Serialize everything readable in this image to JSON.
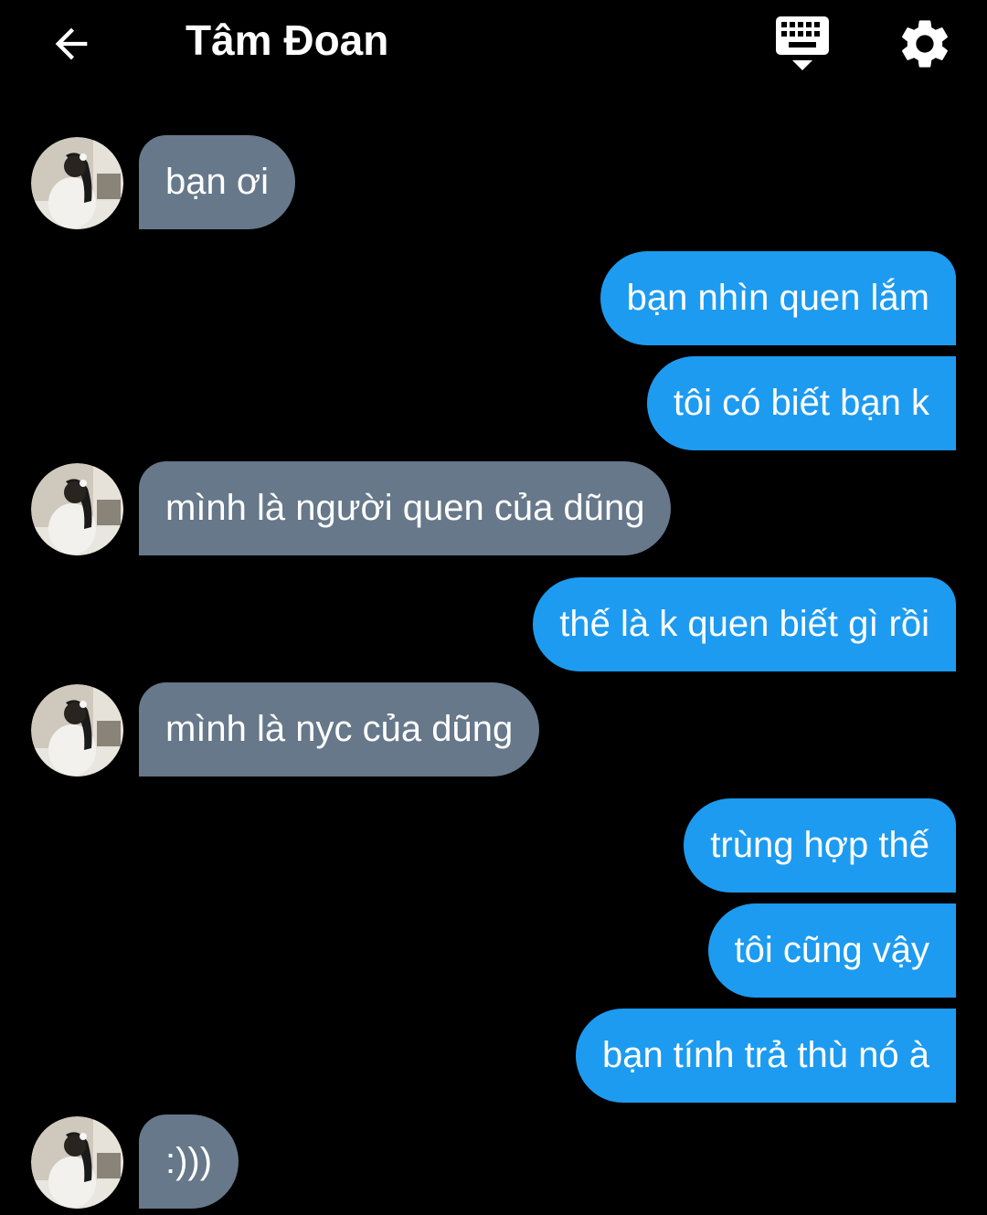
{
  "header": {
    "title": "Tâm Đoan",
    "back_icon": "arrow-left-icon",
    "keyboard_icon": "keyboard-icon",
    "settings_icon": "gear-icon"
  },
  "colors": {
    "background": "#000000",
    "incoming_bubble": "#66788a",
    "outgoing_bubble": "#1d9bf0",
    "text": "#ffffff"
  },
  "messages": [
    {
      "direction": "in",
      "text": "bạn ơi"
    },
    {
      "direction": "out",
      "text": "bạn nhìn quen lắm"
    },
    {
      "direction": "out",
      "text": "tôi có biết bạn k"
    },
    {
      "direction": "in",
      "text": "mình là người quen của dũng"
    },
    {
      "direction": "out",
      "text": "thế là k quen biết gì rồi"
    },
    {
      "direction": "in",
      "text": "mình là nyc của dũng"
    },
    {
      "direction": "out",
      "text": "trùng hợp thế"
    },
    {
      "direction": "out",
      "text": "tôi cũng vậy"
    },
    {
      "direction": "out",
      "text": "bạn tính trả thù nó à"
    },
    {
      "direction": "in",
      "text": ":)))"
    }
  ]
}
